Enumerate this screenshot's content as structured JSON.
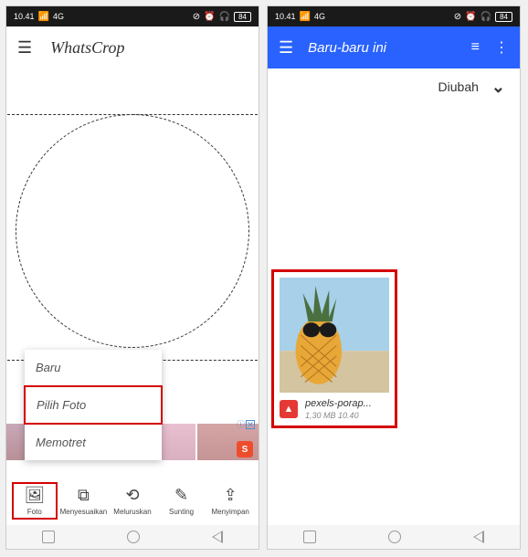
{
  "status": {
    "time": "10.41",
    "signal_label": "4G",
    "battery": "84"
  },
  "left": {
    "app_title": "WhatsCrop",
    "menu": {
      "baru": "Baru",
      "pilih_foto": "Pilih Foto",
      "memotret": "Memotret"
    },
    "ad": {
      "info_glyph": "ⓘ",
      "close_glyph": "✕",
      "shop_glyph": "S"
    },
    "toolbar": {
      "foto": "Foto",
      "menyesuaikan": "Menyesuaikan",
      "meluruskan": "Meluruskan",
      "sunting": "Sunting",
      "menyimpan": "Menyimpan"
    }
  },
  "right": {
    "header_title": "Baru-baru ini",
    "filter_label": "Diubah",
    "file": {
      "name": "pexels-porap...",
      "size": "1,30 MB",
      "time": "10.40"
    }
  }
}
